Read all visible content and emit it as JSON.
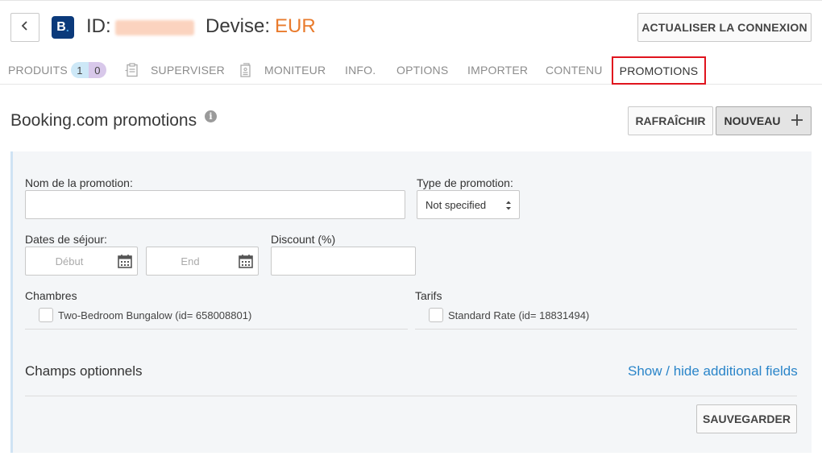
{
  "header": {
    "back_icon": "chevron-left-icon",
    "brand_logo_letter": "B",
    "brand_logo_dot": ".",
    "id_label": "ID:",
    "currency_label": "Devise:",
    "currency_value": "EUR",
    "reconnect_label": "ACTUALISER LA CONNEXION",
    "colors": {
      "brand": "#0b3a7b",
      "currency": "#e97b2d"
    }
  },
  "tabs": [
    {
      "label": "PRODUITS",
      "badges": [
        "1",
        "0"
      ]
    },
    {
      "label": "SUPERVISER",
      "icon": "clipboard-icon"
    },
    {
      "label": "MONITEUR",
      "icon": "document-icon"
    },
    {
      "label": "INFO."
    },
    {
      "label": "OPTIONS"
    },
    {
      "label": "IMPORTER"
    },
    {
      "label": "CONTENU"
    },
    {
      "label": "PROMOTIONS",
      "active": true
    }
  ],
  "section": {
    "title": "Booking.com promotions",
    "info_icon": "i",
    "refresh_label": "RAFRAÎCHIR",
    "new_label": "NOUVEAU"
  },
  "form": {
    "name_label": "Nom de la promotion:",
    "name_value": "",
    "type_label": "Type de promotion:",
    "type_value": "Not specified",
    "dates_label": "Dates de séjour:",
    "start_placeholder": "Début",
    "end_placeholder": "End",
    "discount_label": "Discount (%)",
    "discount_value": "",
    "rooms_label": "Chambres",
    "rooms": [
      "Two-Bedroom Bungalow (id= 658008801)"
    ],
    "rates_label": "Tarifs",
    "rates": [
      "Standard Rate (id= 18831494)"
    ],
    "optional_title": "Champs optionnels",
    "toggle_link": "Show / hide additional fields",
    "save_label": "SAUVEGARDER",
    "colors": {
      "link": "#2a85c9",
      "active_tab_border": "#e0141e"
    }
  }
}
